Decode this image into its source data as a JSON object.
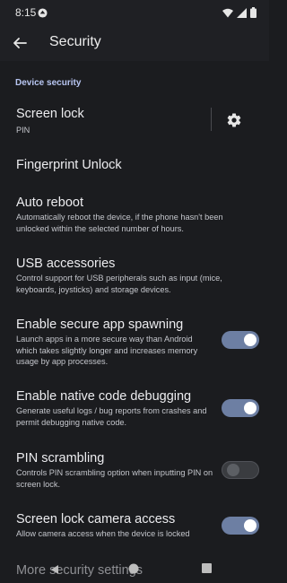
{
  "status": {
    "time": "8:15"
  },
  "appbar": {
    "title": "Security"
  },
  "section": "Device security",
  "items": [
    {
      "title": "Screen lock",
      "summary": "PIN"
    },
    {
      "title": "Fingerprint Unlock"
    },
    {
      "title": "Auto reboot",
      "summary": "Automatically reboot the device, if the phone hasn't been unlocked within the selected number of hours."
    },
    {
      "title": "USB accessories",
      "summary": "Control support for USB peripherals such as input (mice, keyboards, joysticks) and storage devices."
    },
    {
      "title": "Enable secure app spawning",
      "summary": "Launch apps in a more secure way than Android which takes slightly longer and increases memory usage by app processes.",
      "toggle": true
    },
    {
      "title": "Enable native code debugging",
      "summary": "Generate useful logs / bug reports from crashes and permit debugging native code.",
      "toggle": true
    },
    {
      "title": "PIN scrambling",
      "summary": "Controls PIN scrambling option when inputting PIN on screen lock.",
      "toggle": false
    },
    {
      "title": "Screen lock camera access",
      "summary": "Allow camera access when the device is locked",
      "toggle": true
    }
  ],
  "more": {
    "title": "More security settings"
  },
  "icons": [
    "notification-icon",
    "wifi-icon",
    "signal-icon",
    "battery-icon",
    "back-arrow-icon",
    "gear-icon",
    "nav-back-icon",
    "nav-home-icon",
    "nav-recents-icon"
  ],
  "colors": {
    "background": "#1b1c1f",
    "accent": "#b8c6f2",
    "toggle_on": "#6d7fa3"
  }
}
